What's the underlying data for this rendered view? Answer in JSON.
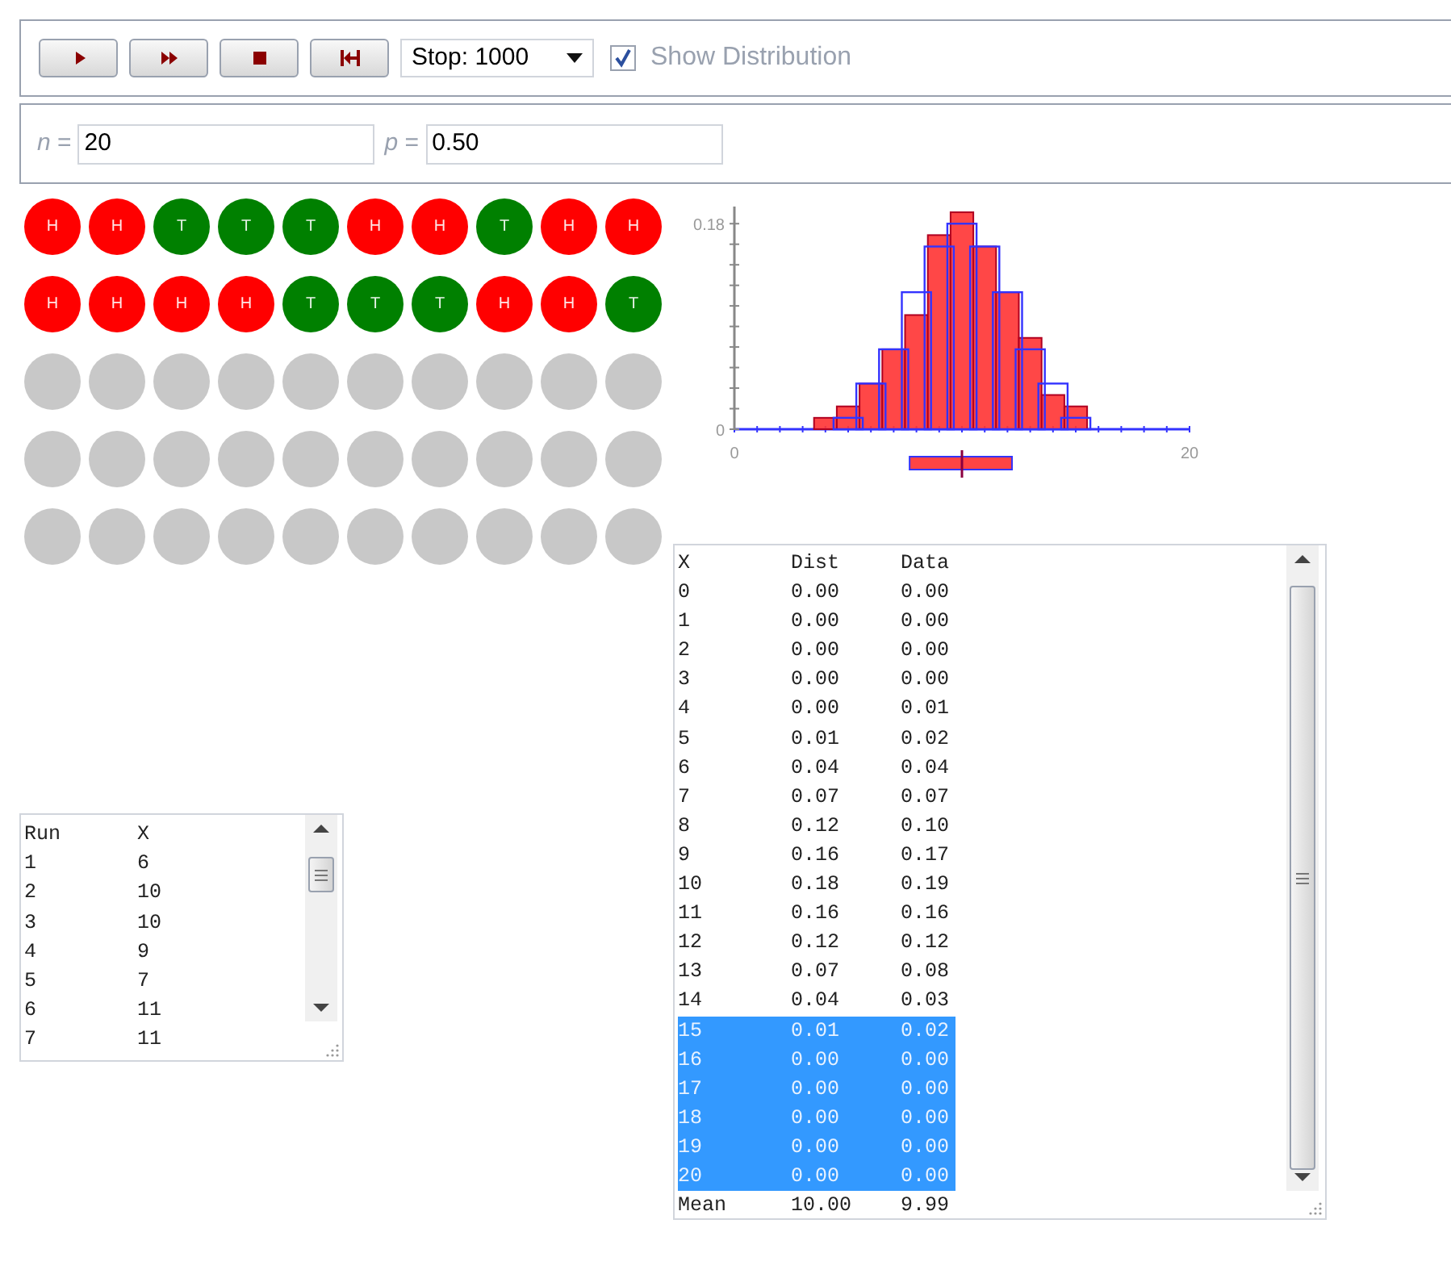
{
  "toolbar": {
    "buttons": [
      {
        "kind": "play"
      },
      {
        "kind": "fast-forward"
      },
      {
        "kind": "stop"
      },
      {
        "kind": "reset"
      }
    ],
    "stop_select": {
      "value": "Stop: 1000"
    },
    "show_distribution": {
      "label": "Show Distribution",
      "checked": true
    }
  },
  "parameters": [
    {
      "label": "*n* =",
      "value": "20"
    },
    {
      "label": "*p* =",
      "value": "0.50"
    }
  ],
  "coin_rows": [
    [
      {
        "kind": "heads",
        "label": "H"
      },
      {
        "kind": "heads",
        "label": "H"
      },
      {
        "kind": "tails",
        "label": "T"
      },
      {
        "kind": "tails",
        "label": "T"
      },
      {
        "kind": "tails",
        "label": "T"
      },
      {
        "kind": "heads",
        "label": "H"
      },
      {
        "kind": "heads",
        "label": "H"
      },
      {
        "kind": "tails",
        "label": "T"
      },
      {
        "kind": "heads",
        "label": "H"
      },
      {
        "kind": "heads",
        "label": "H"
      }
    ],
    [
      {
        "kind": "heads",
        "label": "H"
      },
      {
        "kind": "heads",
        "label": "H"
      },
      {
        "kind": "heads",
        "label": "H"
      },
      {
        "kind": "heads",
        "label": "H"
      },
      {
        "kind": "tails",
        "label": "T"
      },
      {
        "kind": "tails",
        "label": "T"
      },
      {
        "kind": "tails",
        "label": "T"
      },
      {
        "kind": "heads",
        "label": "H"
      },
      {
        "kind": "heads",
        "label": "H"
      },
      {
        "kind": "tails",
        "label": "T"
      }
    ],
    [
      {
        "kind": "empty"
      },
      {
        "kind": "empty"
      },
      {
        "kind": "empty"
      },
      {
        "kind": "empty"
      },
      {
        "kind": "empty"
      },
      {
        "kind": "empty"
      },
      {
        "kind": "empty"
      },
      {
        "kind": "empty"
      },
      {
        "kind": "empty"
      },
      {
        "kind": "empty"
      }
    ],
    [
      {
        "kind": "empty"
      },
      {
        "kind": "empty"
      },
      {
        "kind": "empty"
      },
      {
        "kind": "empty"
      },
      {
        "kind": "empty"
      },
      {
        "kind": "empty"
      },
      {
        "kind": "empty"
      },
      {
        "kind": "empty"
      },
      {
        "kind": "empty"
      },
      {
        "kind": "empty"
      }
    ],
    [
      {
        "kind": "empty"
      },
      {
        "kind": "empty"
      },
      {
        "kind": "empty"
      },
      {
        "kind": "empty"
      },
      {
        "kind": "empty"
      },
      {
        "kind": "empty"
      },
      {
        "kind": "empty"
      },
      {
        "kind": "empty"
      },
      {
        "kind": "empty"
      },
      {
        "kind": "empty"
      }
    ]
  ],
  "histogram": {
    "chart_data": {
      "type": "bar",
      "x": [
        0,
        1,
        2,
        3,
        4,
        5,
        6,
        7,
        8,
        9,
        10,
        11,
        12,
        13,
        14,
        15,
        16,
        17,
        18,
        19,
        20
      ],
      "series": [
        {
          "color": "#3333ff",
          "values": [
            0.0,
            0.0,
            0.0,
            0.0,
            0.0,
            0.01,
            0.04,
            0.07,
            0.12,
            0.16,
            0.18,
            0.16,
            0.12,
            0.07,
            0.04,
            0.01,
            0.0,
            0.0,
            0.0,
            0.0,
            0.0
          ]
        },
        {
          "color": "#ff3333",
          "values": [
            0.0,
            0.0,
            0.0,
            0.0,
            0.01,
            0.02,
            0.04,
            0.07,
            0.1,
            0.17,
            0.19,
            0.16,
            0.12,
            0.08,
            0.03,
            0.02,
            0.0,
            0.0,
            0.0,
            0.0,
            0.0
          ]
        }
      ],
      "xticks": [
        0,
        20
      ],
      "yticks": [
        0,
        0.18
      ],
      "xlim": [
        0,
        20
      ],
      "ylim": [
        0,
        0.195
      ]
    }
  },
  "run_table": {
    "columns": [
      "Run",
      "X"
    ],
    "rows": [
      [
        "1",
        "6"
      ],
      [
        "2",
        "10"
      ],
      [
        "3",
        "10"
      ],
      [
        "4",
        "9"
      ],
      [
        "5",
        "7"
      ],
      [
        "6",
        "11"
      ],
      [
        "7",
        "11"
      ]
    ]
  },
  "distribution_table": {
    "columns": [
      "X",
      "Dist",
      "Data"
    ],
    "rows": [
      {
        "cells": [
          "0",
          "0.00",
          "0.00"
        ],
        "selected": false
      },
      {
        "cells": [
          "1",
          "0.00",
          "0.00"
        ],
        "selected": false
      },
      {
        "cells": [
          "2",
          "0.00",
          "0.00"
        ],
        "selected": false
      },
      {
        "cells": [
          "3",
          "0.00",
          "0.00"
        ],
        "selected": false
      },
      {
        "cells": [
          "4",
          "0.00",
          "0.01"
        ],
        "selected": false
      },
      {
        "cells": [
          "5",
          "0.01",
          "0.02"
        ],
        "selected": false
      },
      {
        "cells": [
          "6",
          "0.04",
          "0.04"
        ],
        "selected": false
      },
      {
        "cells": [
          "7",
          "0.07",
          "0.07"
        ],
        "selected": false
      },
      {
        "cells": [
          "8",
          "0.12",
          "0.10"
        ],
        "selected": false
      },
      {
        "cells": [
          "9",
          "0.16",
          "0.17"
        ],
        "selected": false
      },
      {
        "cells": [
          "10",
          "0.18",
          "0.19"
        ],
        "selected": false
      },
      {
        "cells": [
          "11",
          "0.16",
          "0.16"
        ],
        "selected": false
      },
      {
        "cells": [
          "12",
          "0.12",
          "0.12"
        ],
        "selected": false
      },
      {
        "cells": [
          "13",
          "0.07",
          "0.08"
        ],
        "selected": false
      },
      {
        "cells": [
          "14",
          "0.04",
          "0.03"
        ],
        "selected": false
      },
      {
        "cells": [
          "15",
          "0.01",
          "0.02"
        ],
        "selected": true
      },
      {
        "cells": [
          "16",
          "0.00",
          "0.00"
        ],
        "selected": true
      },
      {
        "cells": [
          "17",
          "0.00",
          "0.00"
        ],
        "selected": true
      },
      {
        "cells": [
          "18",
          "0.00",
          "0.00"
        ],
        "selected": true
      },
      {
        "cells": [
          "19",
          "0.00",
          "0.00"
        ],
        "selected": true
      },
      {
        "cells": [
          "20",
          "0.00",
          "0.00"
        ],
        "selected": true
      },
      {
        "cells": [
          "Mean",
          "10.00",
          "9.99"
        ],
        "selected": false
      }
    ]
  }
}
